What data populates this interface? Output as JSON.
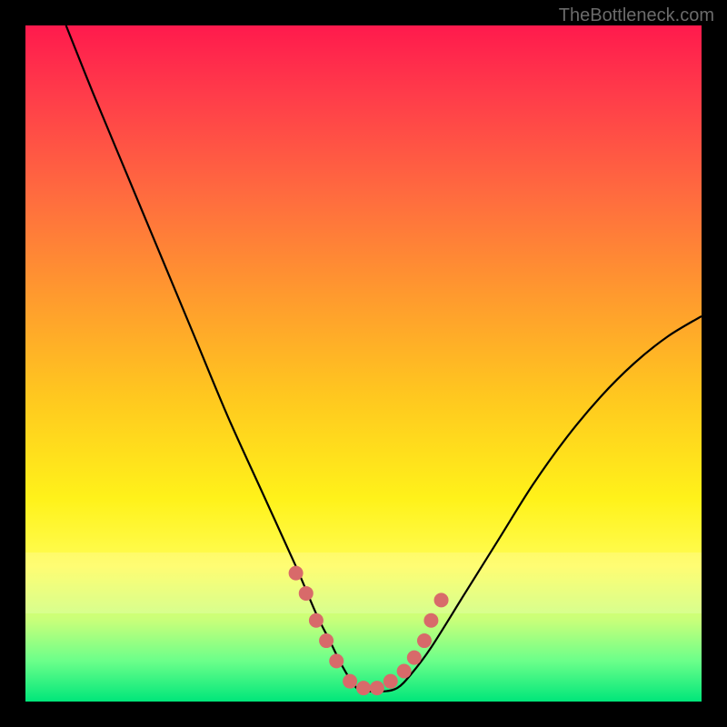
{
  "watermark": "TheBottleneck.com",
  "colors": {
    "frame": "#000000",
    "curve_stroke": "#000000",
    "marker_fill": "#d86a6a",
    "marker_stroke": "#b84a4a"
  },
  "chart_data": {
    "type": "line",
    "title": "",
    "xlabel": "",
    "ylabel": "",
    "xlim": [
      0,
      100
    ],
    "ylim": [
      0,
      100
    ],
    "grid": false,
    "legend": false,
    "series": [
      {
        "name": "bottleneck-curve",
        "x": [
          6,
          10,
          15,
          20,
          25,
          30,
          35,
          40,
          43,
          45,
          47,
          49,
          51,
          53,
          55,
          57,
          60,
          65,
          70,
          75,
          80,
          85,
          90,
          95,
          100
        ],
        "y": [
          100,
          90,
          78,
          66,
          54,
          42,
          31,
          20,
          13,
          9,
          5,
          2,
          1.5,
          1.5,
          2,
          4,
          8,
          16,
          24,
          32,
          39,
          45,
          50,
          54,
          57
        ]
      }
    ],
    "markers": {
      "name": "highlight-points",
      "x": [
        40,
        41.5,
        43,
        44.5,
        46,
        48,
        50,
        52,
        54,
        56,
        57.5,
        59,
        60,
        61.5
      ],
      "y": [
        19,
        16,
        12,
        9,
        6,
        3,
        2,
        2,
        3,
        4.5,
        6.5,
        9,
        12,
        15
      ]
    }
  }
}
